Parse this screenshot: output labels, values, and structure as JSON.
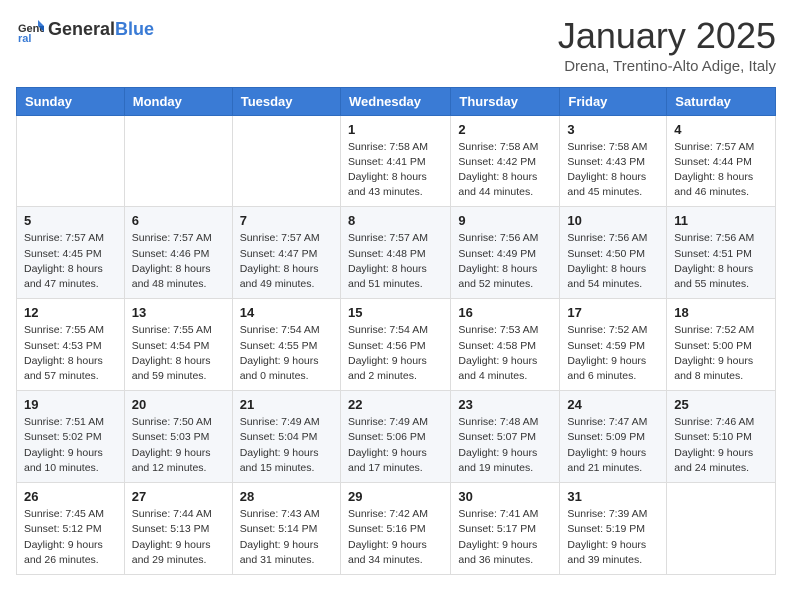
{
  "header": {
    "logo": {
      "general": "General",
      "blue": "Blue"
    },
    "title": "January 2025",
    "location": "Drena, Trentino-Alto Adige, Italy"
  },
  "weekdays": [
    "Sunday",
    "Monday",
    "Tuesday",
    "Wednesday",
    "Thursday",
    "Friday",
    "Saturday"
  ],
  "weeks": [
    [
      {
        "day": "",
        "sunrise": "",
        "sunset": "",
        "daylight": ""
      },
      {
        "day": "",
        "sunrise": "",
        "sunset": "",
        "daylight": ""
      },
      {
        "day": "",
        "sunrise": "",
        "sunset": "",
        "daylight": ""
      },
      {
        "day": "1",
        "sunrise": "Sunrise: 7:58 AM",
        "sunset": "Sunset: 4:41 PM",
        "daylight": "Daylight: 8 hours and 43 minutes."
      },
      {
        "day": "2",
        "sunrise": "Sunrise: 7:58 AM",
        "sunset": "Sunset: 4:42 PM",
        "daylight": "Daylight: 8 hours and 44 minutes."
      },
      {
        "day": "3",
        "sunrise": "Sunrise: 7:58 AM",
        "sunset": "Sunset: 4:43 PM",
        "daylight": "Daylight: 8 hours and 45 minutes."
      },
      {
        "day": "4",
        "sunrise": "Sunrise: 7:57 AM",
        "sunset": "Sunset: 4:44 PM",
        "daylight": "Daylight: 8 hours and 46 minutes."
      }
    ],
    [
      {
        "day": "5",
        "sunrise": "Sunrise: 7:57 AM",
        "sunset": "Sunset: 4:45 PM",
        "daylight": "Daylight: 8 hours and 47 minutes."
      },
      {
        "day": "6",
        "sunrise": "Sunrise: 7:57 AM",
        "sunset": "Sunset: 4:46 PM",
        "daylight": "Daylight: 8 hours and 48 minutes."
      },
      {
        "day": "7",
        "sunrise": "Sunrise: 7:57 AM",
        "sunset": "Sunset: 4:47 PM",
        "daylight": "Daylight: 8 hours and 49 minutes."
      },
      {
        "day": "8",
        "sunrise": "Sunrise: 7:57 AM",
        "sunset": "Sunset: 4:48 PM",
        "daylight": "Daylight: 8 hours and 51 minutes."
      },
      {
        "day": "9",
        "sunrise": "Sunrise: 7:56 AM",
        "sunset": "Sunset: 4:49 PM",
        "daylight": "Daylight: 8 hours and 52 minutes."
      },
      {
        "day": "10",
        "sunrise": "Sunrise: 7:56 AM",
        "sunset": "Sunset: 4:50 PM",
        "daylight": "Daylight: 8 hours and 54 minutes."
      },
      {
        "day": "11",
        "sunrise": "Sunrise: 7:56 AM",
        "sunset": "Sunset: 4:51 PM",
        "daylight": "Daylight: 8 hours and 55 minutes."
      }
    ],
    [
      {
        "day": "12",
        "sunrise": "Sunrise: 7:55 AM",
        "sunset": "Sunset: 4:53 PM",
        "daylight": "Daylight: 8 hours and 57 minutes."
      },
      {
        "day": "13",
        "sunrise": "Sunrise: 7:55 AM",
        "sunset": "Sunset: 4:54 PM",
        "daylight": "Daylight: 8 hours and 59 minutes."
      },
      {
        "day": "14",
        "sunrise": "Sunrise: 7:54 AM",
        "sunset": "Sunset: 4:55 PM",
        "daylight": "Daylight: 9 hours and 0 minutes."
      },
      {
        "day": "15",
        "sunrise": "Sunrise: 7:54 AM",
        "sunset": "Sunset: 4:56 PM",
        "daylight": "Daylight: 9 hours and 2 minutes."
      },
      {
        "day": "16",
        "sunrise": "Sunrise: 7:53 AM",
        "sunset": "Sunset: 4:58 PM",
        "daylight": "Daylight: 9 hours and 4 minutes."
      },
      {
        "day": "17",
        "sunrise": "Sunrise: 7:52 AM",
        "sunset": "Sunset: 4:59 PM",
        "daylight": "Daylight: 9 hours and 6 minutes."
      },
      {
        "day": "18",
        "sunrise": "Sunrise: 7:52 AM",
        "sunset": "Sunset: 5:00 PM",
        "daylight": "Daylight: 9 hours and 8 minutes."
      }
    ],
    [
      {
        "day": "19",
        "sunrise": "Sunrise: 7:51 AM",
        "sunset": "Sunset: 5:02 PM",
        "daylight": "Daylight: 9 hours and 10 minutes."
      },
      {
        "day": "20",
        "sunrise": "Sunrise: 7:50 AM",
        "sunset": "Sunset: 5:03 PM",
        "daylight": "Daylight: 9 hours and 12 minutes."
      },
      {
        "day": "21",
        "sunrise": "Sunrise: 7:49 AM",
        "sunset": "Sunset: 5:04 PM",
        "daylight": "Daylight: 9 hours and 15 minutes."
      },
      {
        "day": "22",
        "sunrise": "Sunrise: 7:49 AM",
        "sunset": "Sunset: 5:06 PM",
        "daylight": "Daylight: 9 hours and 17 minutes."
      },
      {
        "day": "23",
        "sunrise": "Sunrise: 7:48 AM",
        "sunset": "Sunset: 5:07 PM",
        "daylight": "Daylight: 9 hours and 19 minutes."
      },
      {
        "day": "24",
        "sunrise": "Sunrise: 7:47 AM",
        "sunset": "Sunset: 5:09 PM",
        "daylight": "Daylight: 9 hours and 21 minutes."
      },
      {
        "day": "25",
        "sunrise": "Sunrise: 7:46 AM",
        "sunset": "Sunset: 5:10 PM",
        "daylight": "Daylight: 9 hours and 24 minutes."
      }
    ],
    [
      {
        "day": "26",
        "sunrise": "Sunrise: 7:45 AM",
        "sunset": "Sunset: 5:12 PM",
        "daylight": "Daylight: 9 hours and 26 minutes."
      },
      {
        "day": "27",
        "sunrise": "Sunrise: 7:44 AM",
        "sunset": "Sunset: 5:13 PM",
        "daylight": "Daylight: 9 hours and 29 minutes."
      },
      {
        "day": "28",
        "sunrise": "Sunrise: 7:43 AM",
        "sunset": "Sunset: 5:14 PM",
        "daylight": "Daylight: 9 hours and 31 minutes."
      },
      {
        "day": "29",
        "sunrise": "Sunrise: 7:42 AM",
        "sunset": "Sunset: 5:16 PM",
        "daylight": "Daylight: 9 hours and 34 minutes."
      },
      {
        "day": "30",
        "sunrise": "Sunrise: 7:41 AM",
        "sunset": "Sunset: 5:17 PM",
        "daylight": "Daylight: 9 hours and 36 minutes."
      },
      {
        "day": "31",
        "sunrise": "Sunrise: 7:39 AM",
        "sunset": "Sunset: 5:19 PM",
        "daylight": "Daylight: 9 hours and 39 minutes."
      },
      {
        "day": "",
        "sunrise": "",
        "sunset": "",
        "daylight": ""
      }
    ]
  ]
}
